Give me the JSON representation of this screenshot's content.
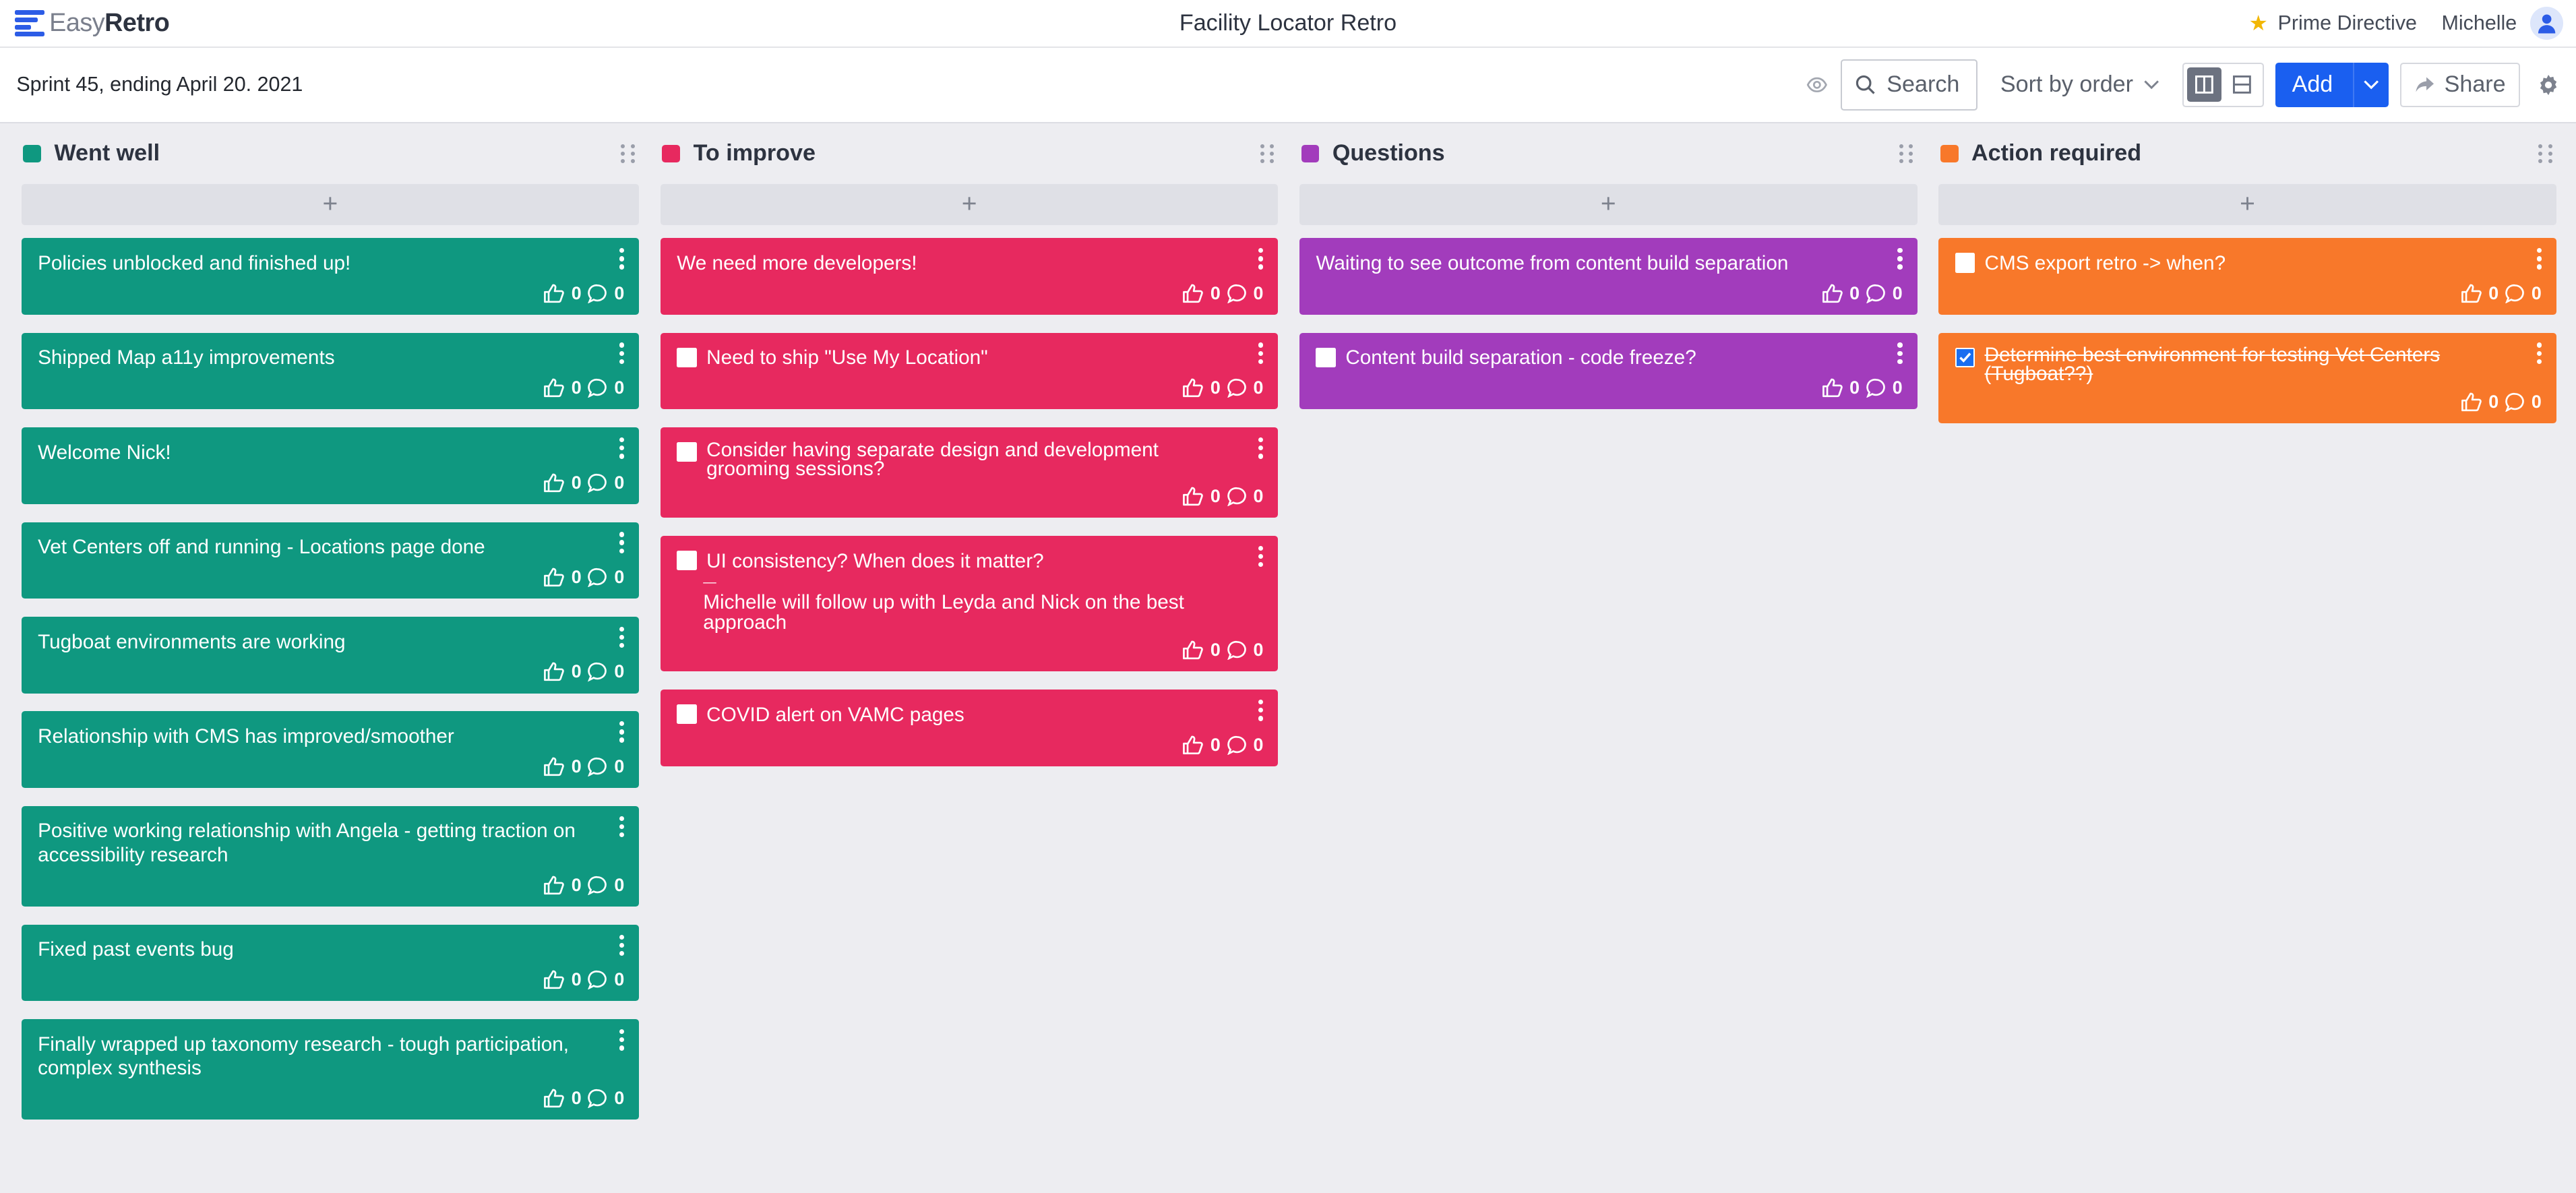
{
  "app": {
    "logo_light": "Easy",
    "logo_bold": "Retro",
    "board_title": "Facility Locator Retro",
    "prime_directive": "Prime Directive",
    "user": "Michelle"
  },
  "toolbar": {
    "sprint": "Sprint 45, ending April 20. 2021",
    "search_label": "Search",
    "sort_label": "Sort by order",
    "add_label": "Add",
    "share_label": "Share"
  },
  "colors": {
    "went_well": "#0f9880",
    "to_improve": "#e7295f",
    "questions": "#a23cbc",
    "action_required": "#f8782a",
    "accent": "#1a5ff0"
  },
  "columns": [
    {
      "title": "Went well",
      "add": "+",
      "cards": [
        {
          "text": "Policies unblocked and finished up!",
          "likes": "0",
          "comments": "0"
        },
        {
          "text": "Shipped Map a11y improvements",
          "likes": "0",
          "comments": "0"
        },
        {
          "text": "Welcome Nick!",
          "likes": "0",
          "comments": "0"
        },
        {
          "text": "Vet Centers off and running - Locations page done",
          "likes": "0",
          "comments": "0"
        },
        {
          "text": "Tugboat environments are working",
          "likes": "0",
          "comments": "0"
        },
        {
          "text": "Relationship with CMS has improved/smoother",
          "likes": "0",
          "comments": "0"
        },
        {
          "text": "Positive working relationship with Angela - getting traction on accessibility research",
          "likes": "0",
          "comments": "0"
        },
        {
          "text": "Fixed past events bug",
          "likes": "0",
          "comments": "0"
        },
        {
          "text": "Finally wrapped up taxonomy research - tough participation, complex synthesis",
          "likes": "0",
          "comments": "0"
        }
      ]
    },
    {
      "title": "To improve",
      "add": "+",
      "cards": [
        {
          "text": "We need more developers!",
          "likes": "0",
          "comments": "0"
        },
        {
          "text": "Need to ship \"Use My Location\"",
          "likes": "0",
          "comments": "0"
        },
        {
          "text": "Consider having separate design and development grooming sessions?",
          "likes": "0",
          "comments": "0"
        },
        {
          "text": "UI consistency? When does it matter?",
          "divider": "—",
          "note": "Michelle will follow up with Leyda and Nick on the best approach",
          "likes": "0",
          "comments": "0"
        },
        {
          "text": "COVID alert on VAMC pages",
          "likes": "0",
          "comments": "0"
        }
      ]
    },
    {
      "title": "Questions",
      "add": "+",
      "cards": [
        {
          "text": "Waiting to see outcome from content build separation",
          "likes": "0",
          "comments": "0"
        },
        {
          "text": "Content build separation - code freeze?",
          "likes": "0",
          "comments": "0"
        }
      ]
    },
    {
      "title": "Action required",
      "add": "+",
      "cards": [
        {
          "text": "CMS export retro -> when?",
          "likes": "0",
          "comments": "0"
        },
        {
          "text": "Determine best environment for testing Vet Centers (Tugboat??)",
          "likes": "0",
          "comments": "0"
        }
      ]
    }
  ]
}
